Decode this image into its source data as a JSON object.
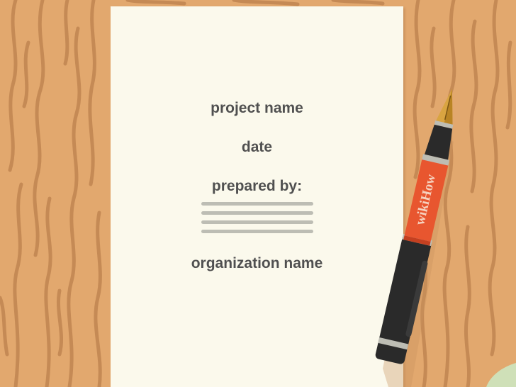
{
  "document": {
    "project_label": "project name",
    "date_label": "date",
    "prepared_label": "prepared by:",
    "signature_lines": 4,
    "organization_label": "organization name"
  },
  "pen": {
    "brand": "wikiHow",
    "icon": "fountain-pen-icon"
  },
  "colors": {
    "wood": "#e2a86e",
    "wood_grain": "#c58a55",
    "paper": "#fbf9ec",
    "text": "#505050",
    "rule": "#bdbdb4",
    "pen_body": "#e8562f",
    "pen_cap": "#2a2a2a",
    "pen_nib": "#d9a441"
  }
}
